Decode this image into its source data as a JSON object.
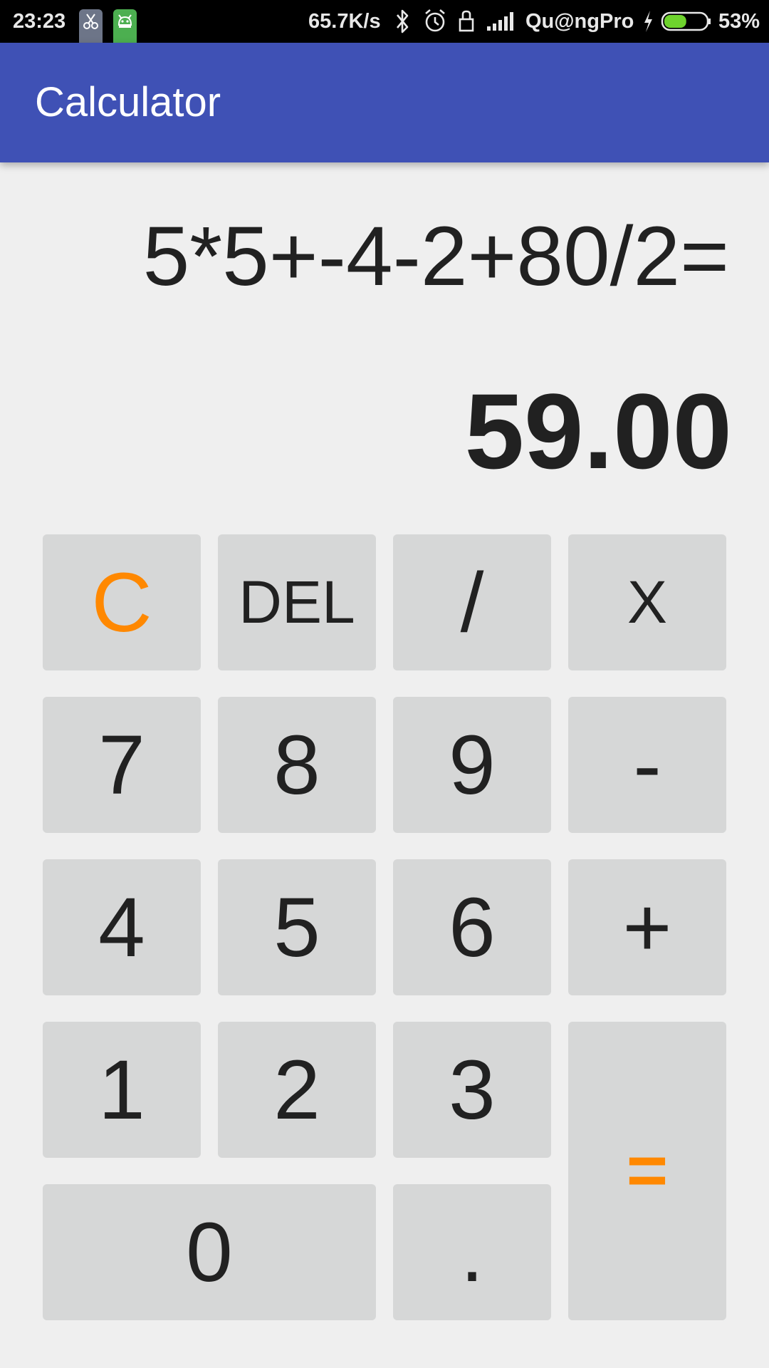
{
  "status_bar": {
    "time": "23:23",
    "icons": [
      "scissors-app-icon",
      "android-app-icon",
      "bluetooth-icon",
      "alarm-icon",
      "lock-icon",
      "signal-icon",
      "charging-icon",
      "battery-icon"
    ],
    "net_speed": "65.7K/s",
    "carrier": "Qu@ngPro",
    "battery_percent": "53%",
    "battery_level": 0.53,
    "battery_color": "#6ed32d"
  },
  "app_bar": {
    "title": "Calculator",
    "color": "#3f51b5"
  },
  "display": {
    "expression": "5*5+-4-2+80/2=",
    "result": "59.00"
  },
  "keys": {
    "clear": "C",
    "delete": "DEL",
    "divide": "/",
    "multiply": "X",
    "seven": "7",
    "eight": "8",
    "nine": "9",
    "minus": "-",
    "four": "4",
    "five": "5",
    "six": "6",
    "plus": "+",
    "one": "1",
    "two": "2",
    "three": "3",
    "equals": "=",
    "zero": "0",
    "dot": "."
  },
  "colors": {
    "accent": "#ff8800",
    "key_background": "#d6d7d7",
    "background": "#efefef"
  }
}
